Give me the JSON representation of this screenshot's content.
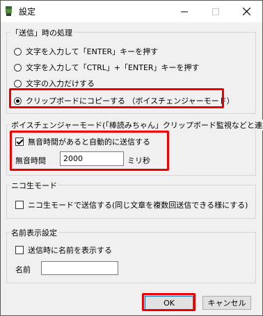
{
  "window": {
    "title": "設定",
    "minimize_icon": "minimize-icon",
    "maximize_icon": "maximize-icon",
    "close_icon": "close-icon"
  },
  "send_group": {
    "legend": "「送信」時の処理",
    "options": [
      {
        "label": "文字を入力して「ENTER」キーを押す",
        "checked": false
      },
      {
        "label": "文字を入力して「CTRL」+「ENTER」キーを押す",
        "checked": false
      },
      {
        "label": "文字の入力だけする",
        "checked": false
      },
      {
        "label": "クリップボードにコピーする （ボイスチェンジャーモード）",
        "checked": true
      }
    ]
  },
  "voice_group": {
    "legend": "ボイスチェンジャーモード(「棒読みちゃん」クリップボード監視などと連携)",
    "auto_send_label": "無音時間があると自動的に送信する",
    "auto_send_checked": true,
    "silence_label": "無音時間",
    "silence_value": "2000",
    "silence_unit": "ミリ秒"
  },
  "nico_group": {
    "legend": "ニコ生モード",
    "option_label": "ニコ生モードで送信する(同じ文章を複数回送信できる様にする)",
    "option_checked": false
  },
  "name_group": {
    "legend": "名前表示設定",
    "option_label": "送信時に名前を表示する",
    "option_checked": false,
    "name_label": "名前",
    "name_value": ""
  },
  "buttons": {
    "ok": "OK",
    "cancel": "キャンセル"
  },
  "colors": {
    "highlight": "#e00000",
    "accent": "#0078d7"
  }
}
